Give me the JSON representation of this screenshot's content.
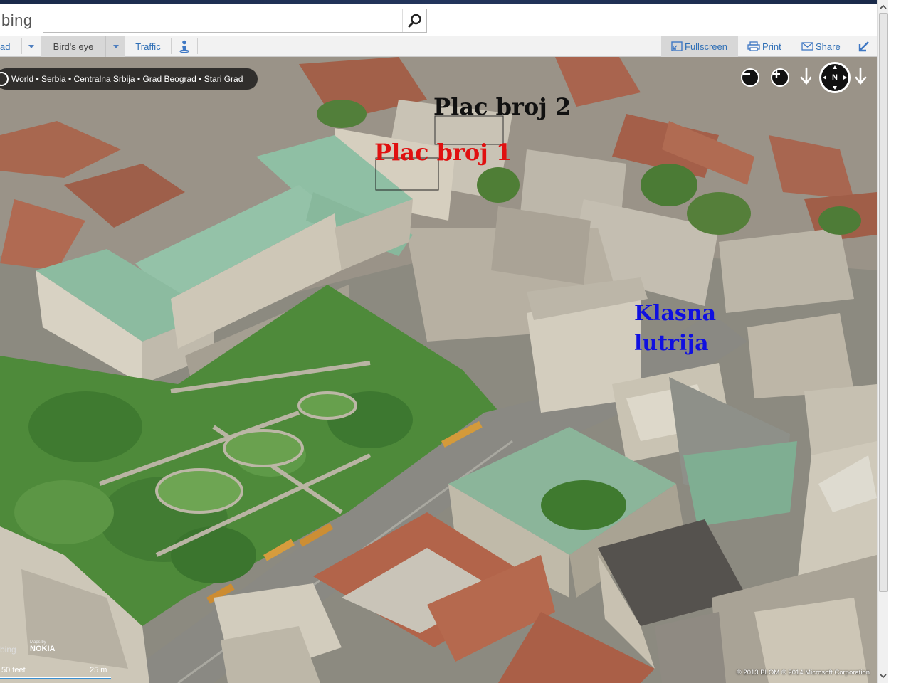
{
  "header": {
    "logo": "bing",
    "search": {
      "value": "",
      "placeholder": ""
    }
  },
  "toolbar": {
    "road_label": "ad",
    "birdseye_label": "Bird's eye",
    "traffic_label": "Traffic",
    "fullscreen_label": "Fullscreen",
    "print_label": "Print",
    "share_label": "Share"
  },
  "map": {
    "breadcrumb": "World • Serbia • Centralna Srbija • Grad Beograd • Stari Grad",
    "compass_label": "N",
    "annotations": {
      "plac2": {
        "text": "Plac broj 2",
        "color": "#111111"
      },
      "plac1": {
        "text": "Plac broj 1",
        "color": "#e01010"
      },
      "klasna_line1": {
        "text": "Klasna",
        "color": "#1010e0"
      },
      "klasna_line2": {
        "text": "lutrija",
        "color": "#1010e0"
      }
    },
    "bottom_logo": "bing",
    "maps_by": "Maps by",
    "nokia": "NOKIA",
    "scale_feet": "50 feet",
    "scale_m": "25 m",
    "copyright": "© 2013 BLOM   © 2014 Microsoft Corporation"
  },
  "colors": {
    "link_blue": "#2f6fb6",
    "roof_green": "#8fbfa4",
    "roof_red": "#b2644a",
    "park_green": "#4e8a3a"
  }
}
